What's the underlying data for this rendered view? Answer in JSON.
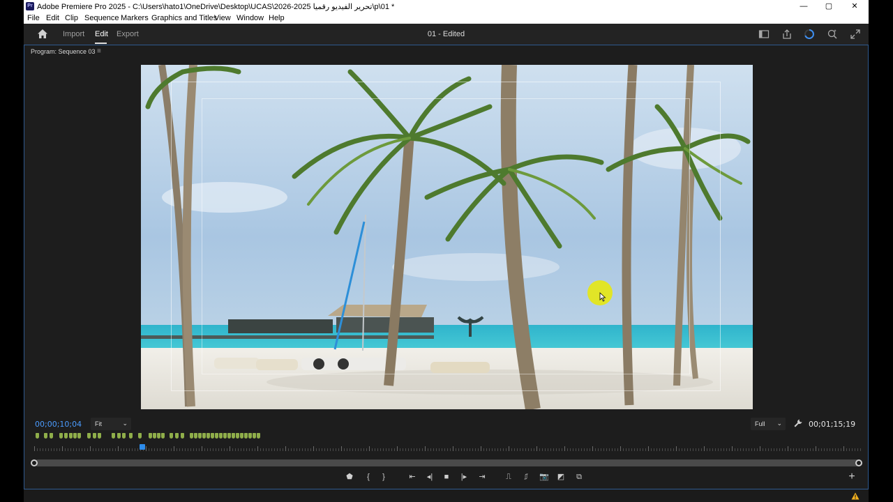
{
  "window": {
    "title": "Adobe Premiere Pro 2025 - C:\\Users\\hato1\\OneDrive\\Desktop\\UCAS\\2026-2025 تحرير الفيديو رقميا\\p\\01 *",
    "app_badge": "Pr",
    "controls": {
      "minimize": "—",
      "maximize": "▢",
      "close": "✕"
    }
  },
  "menu": [
    "File",
    "Edit",
    "Clip",
    "Sequence",
    "Markers",
    "Graphics and Titles",
    "View",
    "Window",
    "Help"
  ],
  "header": {
    "tabs": [
      {
        "label": "Import"
      },
      {
        "label": "Edit"
      },
      {
        "label": "Export"
      }
    ],
    "active_tab": "Edit",
    "document_title": "01 - Edited"
  },
  "program_monitor": {
    "title": "Program: Sequence 03",
    "menu_glyph": "≡",
    "current_timecode": "00;00;10;04",
    "duration_timecode": "00;01;15;19",
    "zoom_select": "Fit",
    "resolution_select": "Full",
    "playhead_position": 0.13
  },
  "transport": {
    "add_marker": "⬟",
    "mark_in": "{",
    "mark_out": "}",
    "go_to_in": "⇤",
    "step_back": "◂|",
    "stop": "■",
    "step_forward": "|▸",
    "go_to_out": "⇥",
    "lift": "⎍",
    "extract": "⎎",
    "export_frame": "📷",
    "comparison_view": "◩",
    "multi_camera": "⧉",
    "button_editor": "+"
  },
  "colors": {
    "accent_blue": "#4b9cff",
    "panel_border": "#2f5a8f",
    "marker_green": "#8fae4a",
    "cursor_highlight": "#e4e61c"
  }
}
